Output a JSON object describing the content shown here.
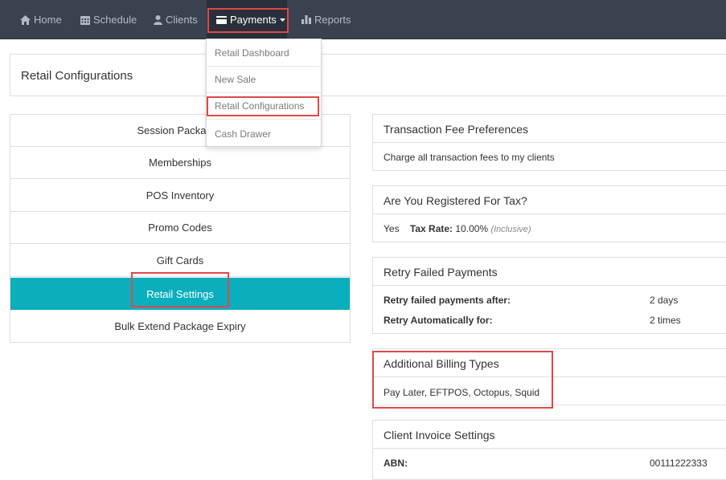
{
  "nav": {
    "home": "Home",
    "schedule": "Schedule",
    "clients": "Clients",
    "payments": "Payments",
    "reports": "Reports"
  },
  "payments_menu": [
    "Retail Dashboard",
    "New Sale",
    "Retail Configurations",
    "Cash Drawer"
  ],
  "page_title": "Retail Configurations",
  "side_menu": [
    "Session Packages",
    "Memberships",
    "POS Inventory",
    "Promo Codes",
    "Gift Cards",
    "Retail Settings",
    "Bulk Extend Package Expiry"
  ],
  "fee_prefs": {
    "title": "Transaction Fee Preferences",
    "text": "Charge all transaction fees to my clients"
  },
  "tax": {
    "title": "Are You Registered For Tax?",
    "answer": "Yes",
    "rate_label": "Tax Rate:",
    "rate_value": "10.00%",
    "rate_note": "(Inclusive)"
  },
  "retry": {
    "title": "Retry Failed Payments",
    "row1_label": "Retry failed payments after:",
    "row1_value": "2 days",
    "row2_label": "Retry Automatically for:",
    "row2_value": "2 times"
  },
  "billing": {
    "title": "Additional Billing Types",
    "text": "Pay Later, EFTPOS, Octopus, Squid"
  },
  "invoice": {
    "title": "Client Invoice Settings",
    "abn_label": "ABN:",
    "abn_value": "00111222333"
  },
  "colors": {
    "navbar": "#3a4250",
    "active_menu": "#0aaebd",
    "highlight": "#e04848"
  }
}
